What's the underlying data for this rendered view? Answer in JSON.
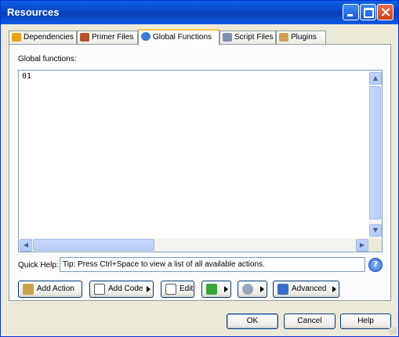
{
  "window": {
    "title": "Resources"
  },
  "tabs": [
    {
      "label": "Dependencies",
      "icon": "box-icon",
      "color": "#e8a317"
    },
    {
      "label": "Primer Files",
      "icon": "wrench-icon",
      "color": "#b5522b"
    },
    {
      "label": "Global Functions",
      "icon": "globe-icon",
      "color": "#3a7bd5",
      "active": true
    },
    {
      "label": "Script Files",
      "icon": "script-icon",
      "color": "#7c8fb0"
    },
    {
      "label": "Plugins",
      "icon": "plug-icon",
      "color": "#d0a050"
    }
  ],
  "editor": {
    "label": "Global functions:",
    "line_number": "01"
  },
  "quick_help": {
    "label": "Quick Help:",
    "text": "Tip: Press Ctrl+Space to view a list of all available actions.",
    "icon": "help-icon"
  },
  "actions": [
    {
      "label": "Add Action",
      "icon": "wand-icon"
    },
    {
      "label": "Add Code",
      "icon": "code-icon"
    },
    {
      "label": "Edit",
      "icon": "edit-icon"
    },
    {
      "label": "",
      "icon": "run-icon"
    },
    {
      "label": "",
      "icon": "tools-icon"
    },
    {
      "label": "Advanced",
      "icon": "save-icon"
    }
  ],
  "dialog": {
    "ok": "OK",
    "cancel": "Cancel",
    "help": "Help"
  }
}
